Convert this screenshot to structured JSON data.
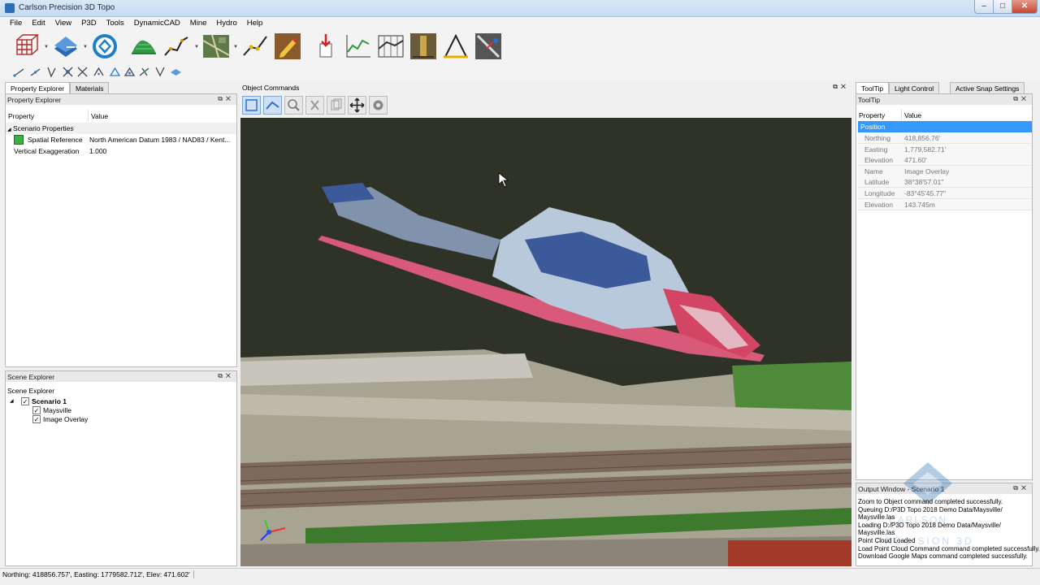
{
  "window": {
    "title": "Carlson Precision 3D Topo",
    "min": "–",
    "max": "□",
    "close": "✕"
  },
  "menu": [
    "File",
    "Edit",
    "View",
    "P3D",
    "Tools",
    "DynamicCAD",
    "Mine",
    "Hydro",
    "Help"
  ],
  "left_tabs": [
    "Property Explorer",
    "Materials"
  ],
  "property_explorer": {
    "title": "Property Explorer",
    "col_property": "Property",
    "col_value": "Value",
    "group": "Scenario Properties",
    "rows": [
      {
        "name": "Spatial Reference",
        "value": "North American Datum 1983 / NAD83 / Kent..."
      },
      {
        "name": "Vertical Exaggeration",
        "value": "1.000"
      }
    ]
  },
  "scene_explorer": {
    "title": "Scene Explorer",
    "subtitle": "Scene Explorer",
    "scenario": "Scenario 1",
    "items": [
      "Maysville",
      "Image Overlay"
    ]
  },
  "object_commands": {
    "title": "Object Commands"
  },
  "right_tabs": [
    "ToolTip",
    "Light Control",
    "Active Snap Settings"
  ],
  "tooltip_panel": {
    "title": "ToolTip",
    "col_property": "Property",
    "col_value": "Value",
    "group": "Position",
    "rows": [
      {
        "name": "Northing",
        "value": "418,856.76'"
      },
      {
        "name": "Easting",
        "value": "1,779,582.71'"
      },
      {
        "name": "Elevation",
        "value": "471.60'"
      },
      {
        "name": "Name",
        "value": "Image Overlay"
      },
      {
        "name": "Latitude",
        "value": "38°38'57.01\""
      },
      {
        "name": "Longitude",
        "value": "-83°45'45.77\""
      },
      {
        "name": "Elevation",
        "value": "143.745m"
      }
    ]
  },
  "output_window": {
    "title": "Output Window - Scenario 1",
    "lines": [
      "Zoom to Object command completed successfully.",
      "Queuing D:/P3D Topo 2018 Demo Data/Maysville/",
      "Maysville.las",
      "Loading D:/P3D Topo 2018 Demo Data/Maysville/",
      "Maysville.las",
      "Point Cloud Loaded",
      "Load Point Cloud Command command completed successfully.",
      "Download Google Maps command completed successfully."
    ],
    "watermark_top": "CARLSON",
    "watermark_bottom": "PRECISION 3D"
  },
  "status": "Northing: 418856.757', Easting: 1779582.712', Elev: 471.602'",
  "colors": {
    "accent": "#3399ff",
    "selection": "#3399ff",
    "titlebar": "#c5daf1"
  }
}
